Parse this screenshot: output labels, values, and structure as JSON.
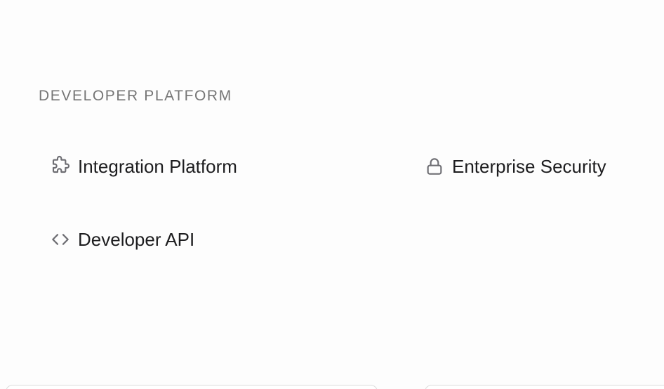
{
  "section": {
    "heading": "DEVELOPER PLATFORM"
  },
  "links": {
    "integration": {
      "label": "Integration Platform",
      "icon": "puzzle-icon"
    },
    "security": {
      "label": "Enterprise Security",
      "icon": "lock-icon"
    },
    "api": {
      "label": "Developer API",
      "icon": "code-icon"
    }
  },
  "colors": {
    "heading": "#757575",
    "text": "#1d1d1f",
    "icon": "#6e6e73",
    "background": "#fdfdfd"
  }
}
